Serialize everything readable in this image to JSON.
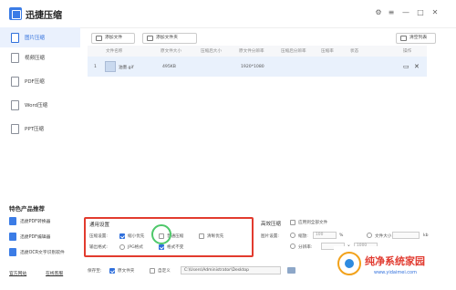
{
  "app": {
    "title": "迅捷压缩",
    "controls": [
      "settings-icon",
      "menu-icon",
      "minimize-icon",
      "maximize-icon",
      "close-icon"
    ]
  },
  "sidebar": {
    "items": [
      {
        "label": "图片压缩",
        "active": true
      },
      {
        "label": "视频压缩",
        "active": false
      },
      {
        "label": "PDF压缩",
        "active": false
      },
      {
        "label": "Word压缩",
        "active": false
      },
      {
        "label": "PPT压缩",
        "active": false
      }
    ],
    "feature_title": "特色产品推荐",
    "features": [
      "迅捷PDF转换器",
      "迅捷PDF编辑器",
      "迅捷OCR文字识别软件"
    ],
    "bottom_links": [
      "官方网站",
      "在线客服"
    ]
  },
  "toolbar": {
    "add_file": "添加文件",
    "add_folder": "添加文件夹",
    "clear_list": "清空列表"
  },
  "table": {
    "headers": [
      "文件名称",
      "原文件大小",
      "压缩后大小",
      "原文件分辨率",
      "压缩后分辨率",
      "压缩率",
      "状态",
      "操作"
    ],
    "rows": [
      {
        "index": "1",
        "name": "油墨.gif",
        "size": "495KB",
        "compressed_size": "",
        "resolution": "1920*1080",
        "compressed_resolution": "",
        "ratio": "",
        "status": ""
      }
    ]
  },
  "general": {
    "title": "通用设置",
    "compress_label": "压缩设置:",
    "options": [
      {
        "label": "缩小优先",
        "checked": true
      },
      {
        "label": "普通压缩",
        "checked": false
      },
      {
        "label": "清晰优先",
        "checked": false
      }
    ],
    "output_label": "输出格式:",
    "formats": [
      {
        "label": "JPG格式",
        "checked": false
      },
      {
        "label": "格式不变",
        "checked": true
      }
    ]
  },
  "advanced": {
    "title": "高效压缩",
    "apply_all": "应用到全部文件",
    "image_label": "图片设置:",
    "width_value": "100",
    "width_unit": "%",
    "size_label": "文件大小",
    "size_unit": "kb",
    "resolution_label": "分辨率:",
    "height_value": "1000",
    "times": "x"
  },
  "save": {
    "label": "保存至:",
    "original_folder": "原文件夹",
    "custom": "自定义",
    "path": "C:\\Users\\Administrator\\Desktop"
  },
  "watermark": {
    "title": "纯净系统家园",
    "url": "www.yidaimei.com"
  }
}
